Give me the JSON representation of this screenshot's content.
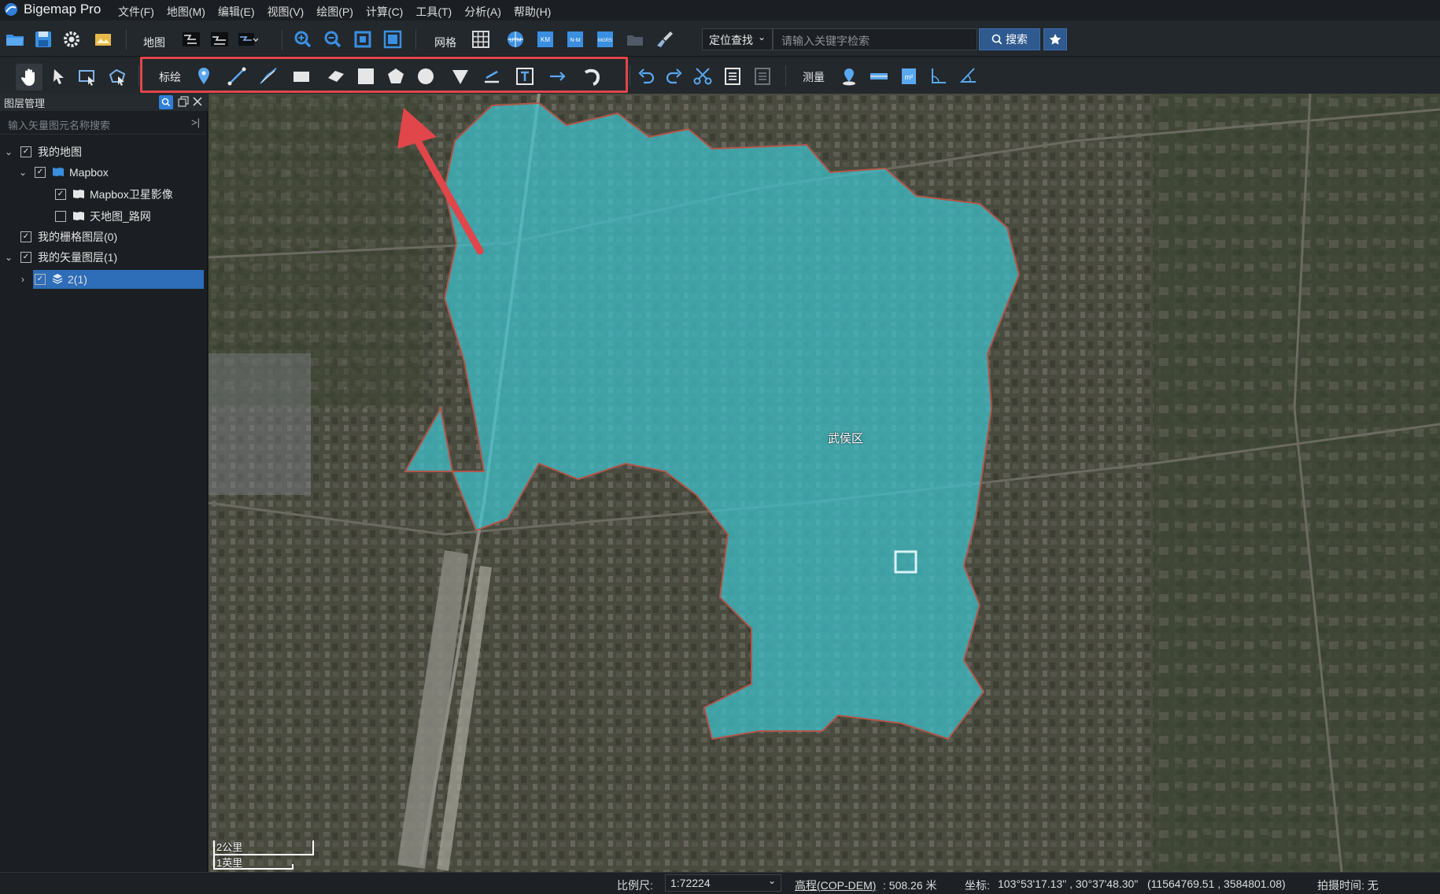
{
  "app": {
    "title": "Bigemap Pro"
  },
  "menu": [
    "文件(F)",
    "地图(M)",
    "编辑(E)",
    "视图(V)",
    "绘图(P)",
    "计算(C)",
    "工具(T)",
    "分析(A)",
    "帮助(H)"
  ],
  "toolbar1": {
    "map_label": "地图",
    "grid_label": "网格",
    "locate_select": "定位查找",
    "search_placeholder": "请输入关键字检索",
    "search_button": "搜索",
    "grid_icons": [
      "UTM",
      "KM",
      "N-M",
      "MGRS"
    ]
  },
  "toolbar2": {
    "draw_label": "标绘",
    "measure_label": "测量"
  },
  "layer_panel": {
    "title": "图层管理",
    "search_placeholder": "输入矢量图元名称搜索",
    "tree": [
      {
        "label": "我的地图",
        "checked": true
      },
      {
        "label": "Mapbox",
        "checked": true
      },
      {
        "label": "Mapbox卫星影像",
        "checked": true
      },
      {
        "label": "天地图_路网",
        "checked": false
      },
      {
        "label": "我的栅格图层(0)",
        "checked": true
      },
      {
        "label": "我的矢量图层(1)",
        "checked": true
      },
      {
        "label": "2(1)",
        "checked": true,
        "selected": true
      }
    ]
  },
  "map": {
    "district_label": "武侯区",
    "scale_km": "2公里",
    "scale_mi": "1英里",
    "polygon_color": "#3fc4cf",
    "arrow_color": "#e0464a"
  },
  "status": {
    "scale_label": "比例尺:",
    "scale_value": "1:72224",
    "elevation_label": "高程(COP-DEM)",
    "elevation_value": "508.26 米",
    "coord_label": "坐标:",
    "coord_value": "103°53'17.13\" , 30°37'48.30\"",
    "projected_value": "(11564769.51 , 3584801.08)",
    "capture_time": "拍摄时间: 无"
  }
}
